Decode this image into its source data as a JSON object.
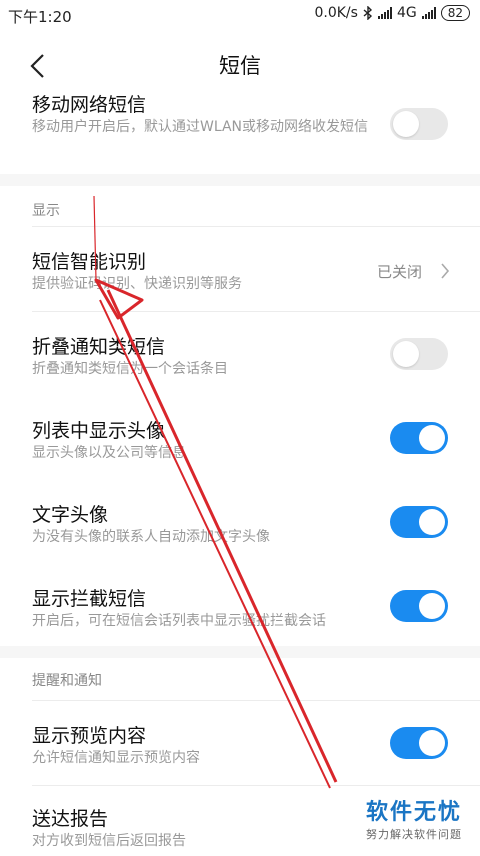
{
  "status_bar": {
    "time": "下午1:20",
    "speed": "0.0K/s",
    "network": "4G",
    "battery": "82"
  },
  "header": {
    "title": "短信"
  },
  "rows": {
    "mobile_network": {
      "title": "移动网络短信",
      "desc": "移动用户开启后，默认通过WLAN或移动网络收发短信",
      "toggle": "off"
    },
    "smart_recognition": {
      "title": "短信智能识别",
      "desc": "提供验证码识别、快递识别等服务",
      "status": "已关闭"
    },
    "fold_notifications": {
      "title": "折叠通知类短信",
      "desc": "折叠通知类短信为一个会话条目",
      "toggle": "off"
    },
    "show_avatar": {
      "title": "列表中显示头像",
      "desc": "显示头像以及公司等信息",
      "toggle": "on"
    },
    "text_avatar": {
      "title": "文字头像",
      "desc": "为没有头像的联系人自动添加文字头像",
      "toggle": "on"
    },
    "show_blocked": {
      "title": "显示拦截短信",
      "desc": "开启后，可在短信会话列表中显示骚扰拦截会话",
      "toggle": "on"
    },
    "show_preview": {
      "title": "显示预览内容",
      "desc": "允许短信通知显示预览内容",
      "toggle": "on"
    },
    "delivery_report": {
      "title": "送达报告",
      "desc": "对方收到短信后返回报告"
    }
  },
  "groups": {
    "display": "显示",
    "reminders": "提醒和通知"
  },
  "watermark": {
    "main": "软件无忧",
    "sub": "努力解决软件问题"
  },
  "colors": {
    "accent": "#1a8bf0",
    "annotation": "#d9262b"
  }
}
